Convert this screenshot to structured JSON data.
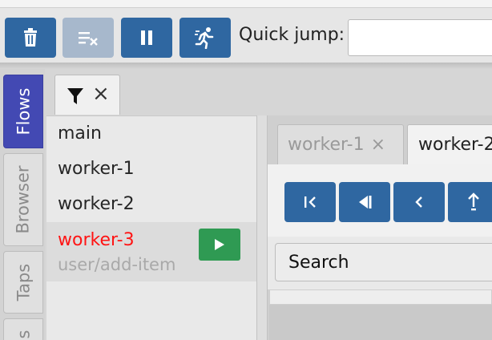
{
  "toolbar": {
    "buttons": [
      {
        "name": "delete",
        "icon": "trash-icon"
      },
      {
        "name": "clear",
        "icon": "clear-list-icon"
      },
      {
        "name": "pause",
        "icon": "pause-icon"
      },
      {
        "name": "run",
        "icon": "running-person-icon"
      }
    ],
    "quick_jump_label": "Quick jump:",
    "quick_jump_value": ""
  },
  "sidetabs": [
    {
      "label": "Flows",
      "active": true
    },
    {
      "label": "Browser",
      "active": false
    },
    {
      "label": "Taps",
      "active": false
    },
    {
      "label": "s",
      "active": false
    }
  ],
  "filter_tab": {
    "icon": "filter-icon",
    "close": "×"
  },
  "flows": [
    {
      "name": "main"
    },
    {
      "name": "worker-1"
    },
    {
      "name": "worker-2"
    },
    {
      "name": "worker-3",
      "sub": "user/add-item",
      "selected": true
    }
  ],
  "worker_tabs": [
    {
      "label": "worker-1",
      "close": "×"
    },
    {
      "label": "worker-2"
    }
  ],
  "nav_buttons": [
    "skip-to-start-icon",
    "step-back-icon",
    "prev-icon",
    "step-up-icon"
  ],
  "search": {
    "placeholder": "Search"
  },
  "colors": {
    "primary": "#2f67a1",
    "active_tab": "#4349b3",
    "selected_flow": "#ff1414",
    "play": "#2f9a53"
  }
}
